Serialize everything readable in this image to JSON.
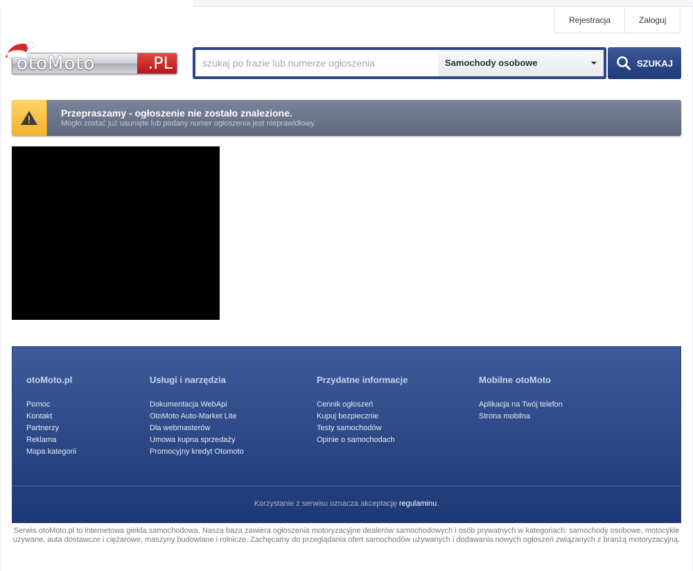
{
  "header": {
    "register_label": "Rejestracja",
    "login_label": "Zaloguj"
  },
  "logo": {
    "text_main": "otoMoto",
    "text_suffix": ".PL",
    "colors": {
      "red": "#c0241f",
      "silver": "#c9ccd2"
    }
  },
  "search": {
    "placeholder": "szukaj po frazie lub numerze ogłoszenia",
    "value": "",
    "category_selected": "Samochody osobowe",
    "button_label": "SZUKAJ",
    "icon": "search-icon"
  },
  "alert": {
    "icon": "warning-icon",
    "title": "Przepraszamy - ogłoszenie nie zostało znalezione.",
    "message": "Mogło zostać już usunięte lub podany numer ogłoszenia jest nieprawidłowy."
  },
  "footer": {
    "columns": [
      {
        "heading": "otoMoto.pl",
        "links": [
          "Pomoc",
          "Kontakt",
          "Partnerzy",
          "Reklama",
          "Mapa kategorii"
        ]
      },
      {
        "heading": "Usługi i narzędzia",
        "links": [
          "Dokumentacja WebApi",
          "OtoMoto Auto-Market Lite",
          "Dla webmasterów",
          "Umowa kupna sprzedaży",
          "Promocyjny kredyt Otomoto"
        ]
      },
      {
        "heading": "Przydatne informacje",
        "links": [
          "Cennik ogłoszeń",
          "Kupuj bezpiecznie",
          "Testy samochodów",
          "Opinie o samochodach"
        ]
      },
      {
        "heading": "Mobilne otoMoto",
        "links": [
          "Aplikacja na Twój telefon",
          "Strona mobilna"
        ]
      }
    ],
    "terms_text": "Korzystanie z serwisu oznacza akceptację",
    "terms_link": "regulaminu",
    "terms_end": "."
  },
  "seo_text": "Serwis otoMoto.pl to internetowa giełda samochodowa. Nasza baza zawiera ogłoszenia motoryzacyjne dealerów samochodowych i osób prywatnych w kategoriach: samochody osobowe, motocykle używane, auta dostawcze i ciężarowe, maszyny budowlane i rolnicze. Zachęcamy do przeglądania ofert samochodów używanych i dodawania nowych ogłoszeń związanych z branżą motoryzacyjną.",
  "colors": {
    "navy": "#2b4584",
    "alert_bg": "#5d667d",
    "warning": "#f3b12c",
    "footer_top": "#3f5b99",
    "footer_bottom": "#1e3775"
  }
}
